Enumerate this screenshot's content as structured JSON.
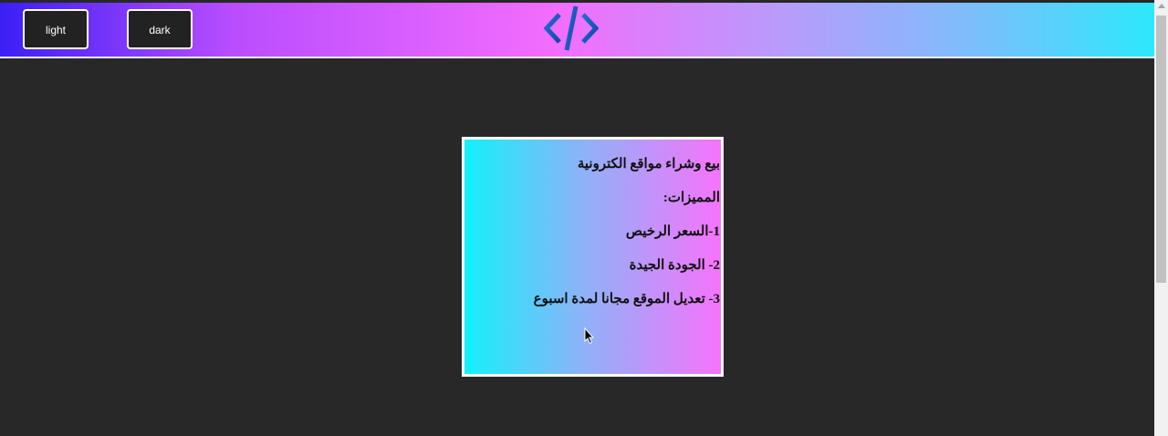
{
  "header": {
    "light_label": "light",
    "dark_label": "dark",
    "logo_icon": "code-brackets-icon",
    "gradient_colors": [
      "#3b1ff5",
      "#b84dff",
      "#f36dfd",
      "#b79cfb",
      "#7ebdfc",
      "#2ce8fc"
    ]
  },
  "card": {
    "title": "بيع وشراء مواقع الكترونية",
    "features_heading": "المميزات:",
    "features": [
      "1-السعر الرخيص",
      "2- الجودة الجيدة",
      "3- تعديل الموقع مجانا لمدة اسبوع"
    ]
  },
  "colors": {
    "background": "#282828",
    "button_bg": "#222222",
    "border": "#ffffff"
  }
}
